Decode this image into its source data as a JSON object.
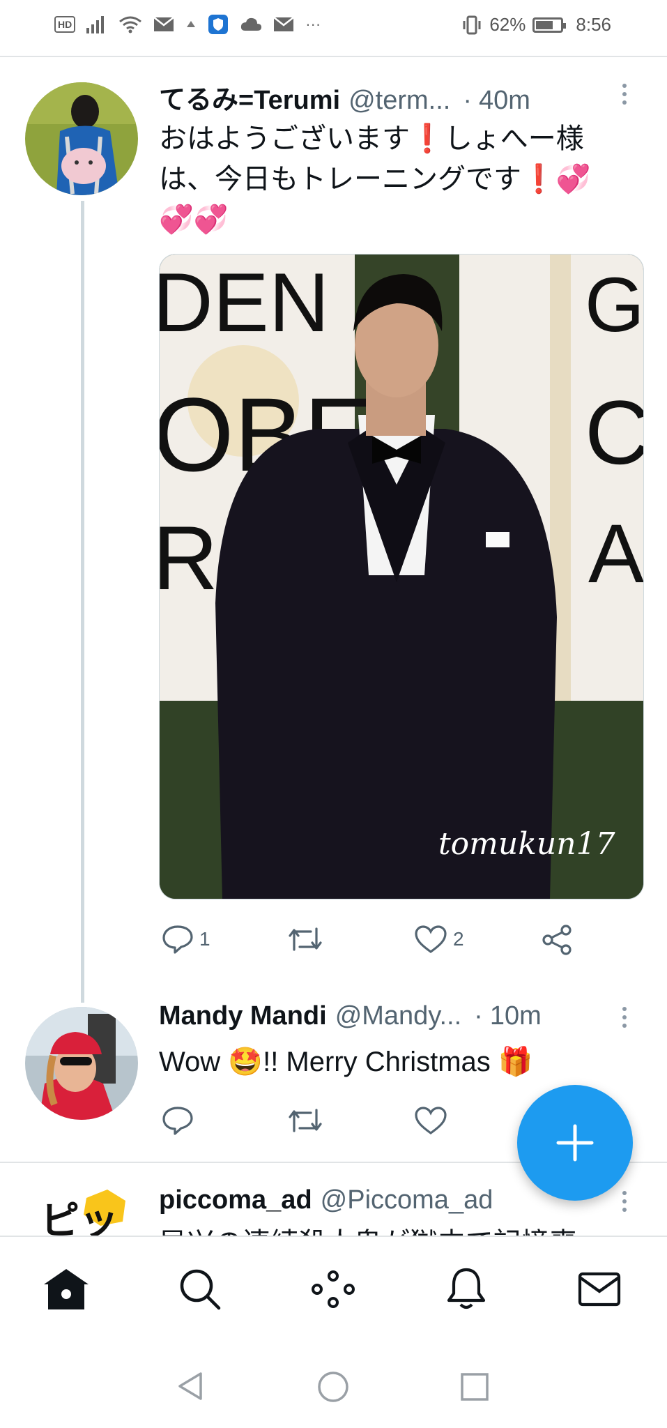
{
  "status_bar": {
    "hd_label": "HD",
    "battery_percent": "62%",
    "time": "8:56",
    "overflow": "···"
  },
  "tweets": [
    {
      "display_name": "てるみ=Terumi",
      "handle": "@term...",
      "separator": "·",
      "time": "40m",
      "text_lines": [
        "おはようございます❗しょへー様",
        "は、今日もトレーニングです❗💞",
        "💞💞"
      ],
      "media_watermark": "tomukun17",
      "reply_count": "1",
      "retweet_count": "",
      "like_count": "2"
    },
    {
      "display_name": "Mandy Mandi",
      "handle": "@Mandy...",
      "separator": "·",
      "time": "10m",
      "text": "Wow 🤩!! Merry Christmas 🎁",
      "reply_count": "",
      "retweet_count": "",
      "like_count": ""
    },
    {
      "display_name": "piccoma_ad",
      "handle": "@Piccoma_ad",
      "text_partial": "异兴の連続殺人鬼が獄中で記憶喪"
    }
  ],
  "avatar_labels": {
    "piccoma": "ピッ"
  },
  "icons": {
    "compose": "plus-icon",
    "nav": [
      "home-icon",
      "search-icon",
      "spaces-icon",
      "notifications-icon",
      "messages-icon"
    ],
    "system": [
      "back-icon",
      "home-circle-icon",
      "recents-icon"
    ]
  },
  "colors": {
    "accent": "#1d9bf0",
    "text_primary": "#0f1419",
    "text_secondary": "#536471"
  }
}
